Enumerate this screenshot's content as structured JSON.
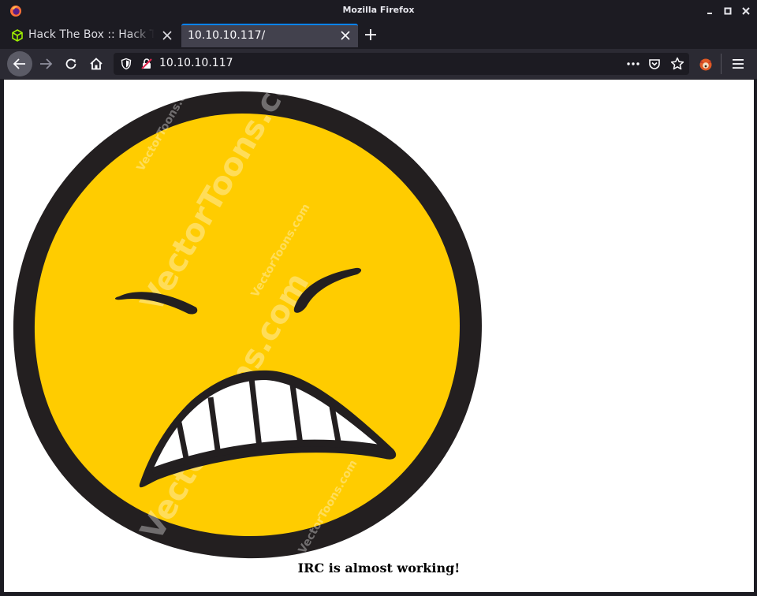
{
  "window": {
    "title": "Mozilla Firefox",
    "controls": [
      "minimize-icon",
      "maximize-icon",
      "close-icon"
    ]
  },
  "tabs": [
    {
      "label": "Hack The Box :: Hack The Box",
      "icon": "hackthebox-cube-icon",
      "active": false
    },
    {
      "label": "10.10.10.117/",
      "icon": "",
      "active": true
    }
  ],
  "navbar": {
    "url": "10.10.10.117",
    "buttons": [
      "back-arrow-icon",
      "forward-arrow-icon",
      "reload-icon",
      "home-icon"
    ],
    "url_icons": [
      "tracking-shield-icon",
      "insecure-lock-icon",
      "more-dots-icon",
      "pocket-icon",
      "bookmark-star-icon"
    ],
    "extension_icon": "foxyproxy-icon",
    "menu_icon": "hamburger-menu-icon"
  },
  "page": {
    "image": "angry-smiley-face",
    "watermark": "VectorToons.com",
    "caption": "IRC is almost working!"
  },
  "colors": {
    "accent": "#0a84ff",
    "chrome_dark": "#1c1b22",
    "toolbar": "#2b2a33",
    "active_tab": "#42414d",
    "face_yellow": "#ffcc00",
    "face_outline": "#231f20"
  }
}
